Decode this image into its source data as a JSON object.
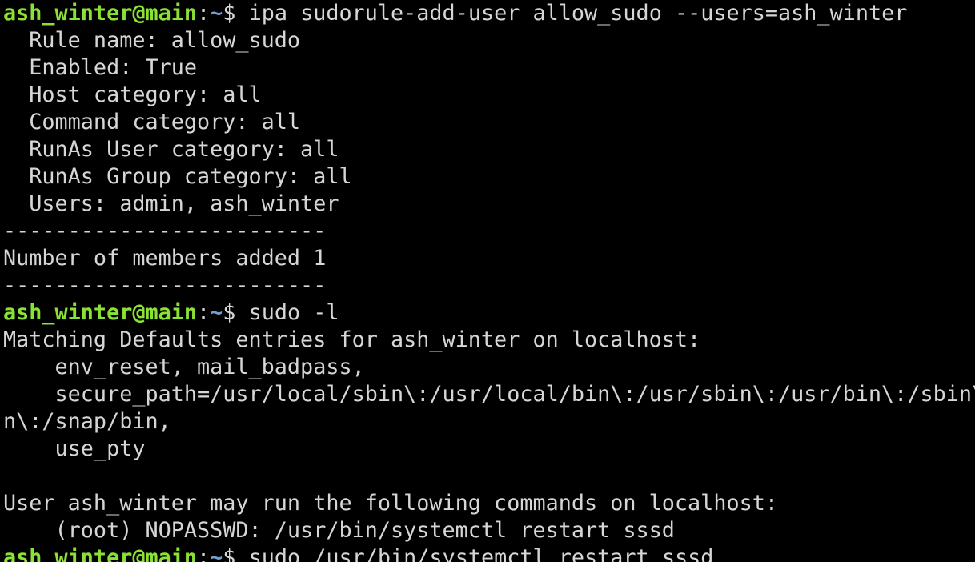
{
  "colors": {
    "background": "#000000",
    "text": "#d6d6d6",
    "prompt_user": "#8ae234",
    "prompt_path": "#729fcf"
  },
  "prompt": {
    "user_host": "ash_winter@main",
    "colon": ":",
    "path": "~",
    "symbol": "$ "
  },
  "commands": {
    "cmd1": "ipa sudorule-add-user allow_sudo --users=ash_winter",
    "cmd2": "sudo -l",
    "cmd3": "sudo /usr/bin/systemctl restart sssd"
  },
  "output": {
    "rule_name": "  Rule name: allow_sudo",
    "enabled": "  Enabled: True",
    "host_category": "  Host category: all",
    "command_category": "  Command category: all",
    "runas_user_category": "  RunAs User category: all",
    "runas_group_category": "  RunAs Group category: all",
    "users": "  Users: admin, ash_winter",
    "separator_top": "-------------------------",
    "members_added": "Number of members added 1",
    "separator_bottom": "-------------------------",
    "matching_defaults": "Matching Defaults entries for ash_winter on localhost:",
    "env_reset": "    env_reset, mail_badpass,",
    "secure_path": "    secure_path=/usr/local/sbin\\:/usr/local/bin\\:/usr/sbin\\:/usr/bin\\:/sbin\\:/bi",
    "secure_path_wrap": "n\\:/snap/bin,",
    "use_pty": "    use_pty",
    "blank": "",
    "may_run": "User ash_winter may run the following commands on localhost:",
    "nopasswd": "    (root) NOPASSWD: /usr/bin/systemctl restart sssd"
  }
}
